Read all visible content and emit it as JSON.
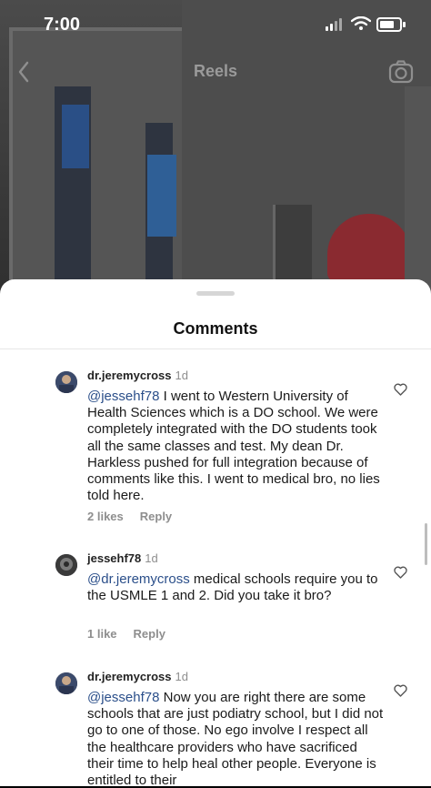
{
  "status_bar": {
    "time": "7:00"
  },
  "header": {
    "title": "Reels"
  },
  "sheet": {
    "title": "Comments"
  },
  "comments": [
    {
      "username": "dr.jeremycross",
      "age": "1d",
      "mention": "@jessehf78",
      "text": " I went to Western University of Health Sciences which is a DO school. We were completely integrated with the DO students took all the same classes and test. My dean Dr. Harkless pushed for full integration because of comments like this.  I went to medical bro, no lies told here.",
      "likes": "2 likes",
      "reply": "Reply"
    },
    {
      "username": "jessehf78",
      "age": "1d",
      "mention": "@dr.jeremycross",
      "text": " medical schools require you to the USMLE 1 and 2.  Did you take it bro?",
      "likes": "1 like",
      "reply": "Reply"
    },
    {
      "username": "dr.jeremycross",
      "age": "1d",
      "mention": "@jessehf78",
      "text": " Now you are right there are some schools that are just podiatry school, but I did not go to one of those. No ego involve I respect all the healthcare providers who have sacrificed their time to help heal other people. Everyone is entitled to their",
      "likes": "",
      "reply": ""
    }
  ]
}
